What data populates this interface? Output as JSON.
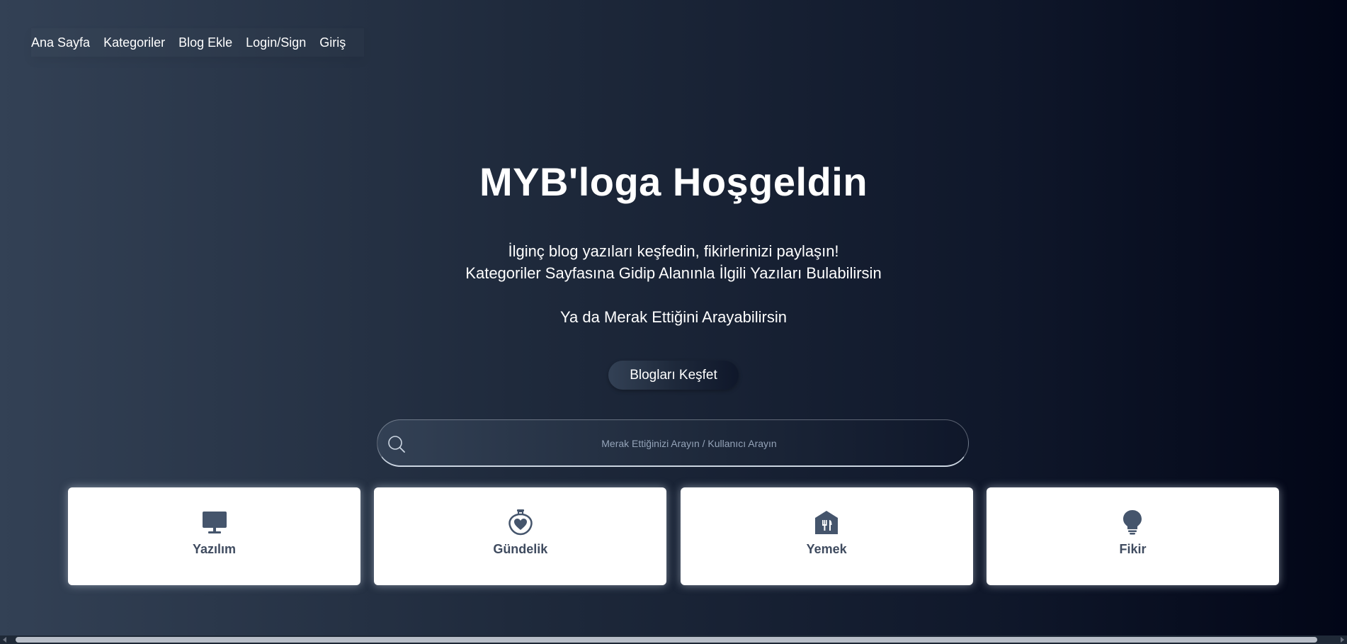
{
  "nav": {
    "items": [
      {
        "label": "Ana Sayfa"
      },
      {
        "label": "Kategoriler"
      },
      {
        "label": "Blog Ekle"
      },
      {
        "label": "Login/Sign"
      },
      {
        "label": "Giriş"
      }
    ]
  },
  "hero": {
    "title": "MYB'loga Hoşgeldin",
    "line1": "İlginç blog yazıları keşfedin, fikirlerinizi paylaşın!",
    "line2": "Kategoriler Sayfasına Gidip Alanınla İlgili Yazıları Bulabilirsin",
    "line3": "Ya da Merak Ettiğini Arayabilirsin",
    "cta_label": "Blogları Keşfet"
  },
  "search": {
    "placeholder": "Merak Ettiğinizi Arayın / Kullanıcı Arayın",
    "value": "",
    "icon": "search-icon"
  },
  "categories": [
    {
      "label": "Yazılım",
      "icon": "monitor-icon"
    },
    {
      "label": "Gündelik",
      "icon": "heart-jar-icon"
    },
    {
      "label": "Yemek",
      "icon": "restaurant-icon"
    },
    {
      "label": "Fikir",
      "icon": "lightbulb-icon"
    }
  ],
  "colors": {
    "icon": "#45556c",
    "card_text": "#3f4b5f",
    "bg_start": "#334155",
    "bg_end": "#020617"
  }
}
